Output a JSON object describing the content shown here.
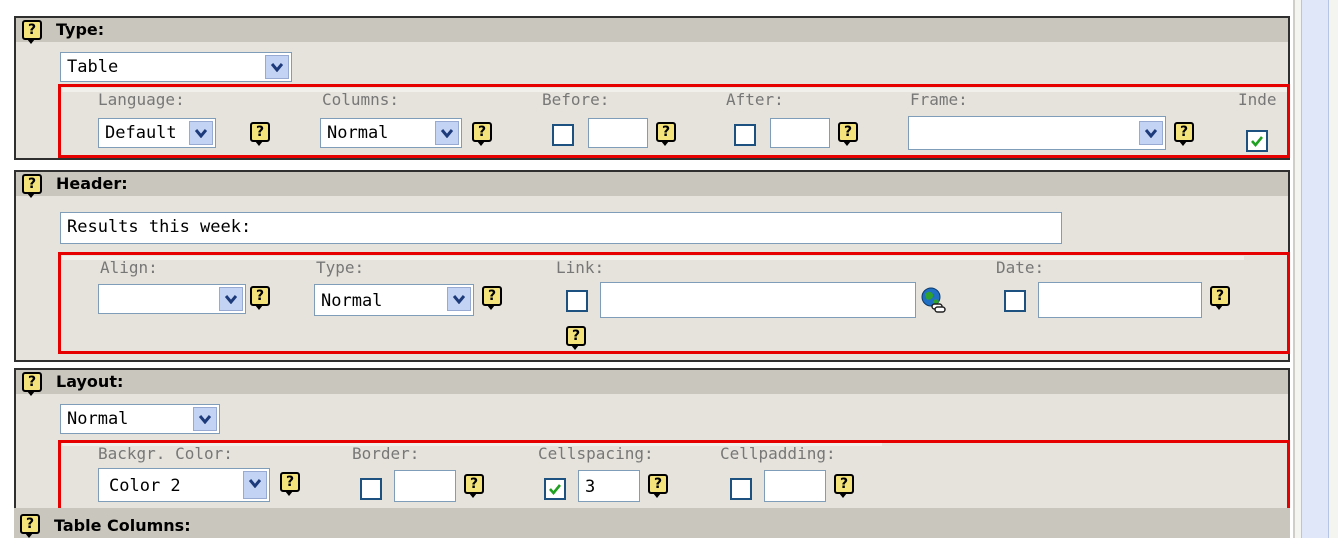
{
  "type_section": {
    "title": "Type:",
    "type_select": "Table",
    "language_label": "Language:",
    "language_value": "Default",
    "columns_label": "Columns:",
    "columns_value": "Normal",
    "before_label": "Before:",
    "before_value": "",
    "after_label": "After:",
    "after_value": "",
    "frame_label": "Frame:",
    "frame_value": "",
    "index_label": "Inde",
    "index_checked": true
  },
  "header_section": {
    "title": "Header:",
    "header_text": "Results this week:",
    "align_label": "Align:",
    "align_value": "",
    "type_label": "Type:",
    "type_value": "Normal",
    "link_label": "Link:",
    "link_value": "",
    "date_label": "Date:",
    "date_value": ""
  },
  "layout_section": {
    "title": "Layout:",
    "layout_select": "Normal",
    "bgcolor_label": "Backgr. Color:",
    "bgcolor_value": "Color 2",
    "border_label": "Border:",
    "border_value": "",
    "cellspacing_label": "Cellspacing:",
    "cellspacing_value": "3",
    "cellspacing_checked": true,
    "cellpadding_label": "Cellpadding:",
    "cellpadding_value": ""
  },
  "table_columns_section": {
    "title": "Table Columns:"
  },
  "help_glyph": "?",
  "icons": {
    "help": "help-icon",
    "link_wizard": "globe-link-icon",
    "dropdown": "chevron-down-icon",
    "checkmark": "checkmark-icon"
  },
  "colors": {
    "highlight_border": "#e60000",
    "help_icon_bg": "#f3e37a",
    "panel_bg": "#e6e3dc",
    "section_header_bg": "#c9c6be"
  }
}
